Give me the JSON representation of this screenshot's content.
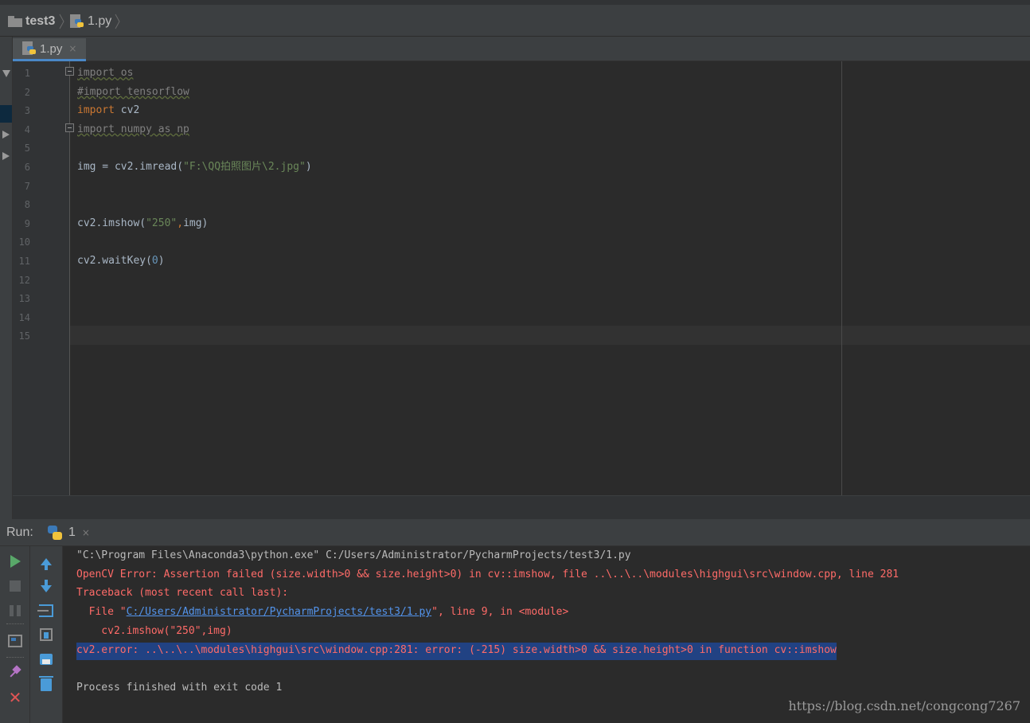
{
  "breadcrumb": {
    "project": "test3",
    "file": "1.py"
  },
  "editor": {
    "tab_label": "1.py",
    "tab_close": "×",
    "lines": [
      {
        "num": "1",
        "segments": [
          {
            "t": "import os",
            "c": "dim"
          }
        ]
      },
      {
        "num": "2",
        "segments": [
          {
            "t": "#import tensorflow",
            "c": "dim"
          }
        ]
      },
      {
        "num": "3",
        "segments": [
          {
            "t": "import ",
            "c": "kw"
          },
          {
            "t": "cv2",
            "c": ""
          }
        ]
      },
      {
        "num": "4",
        "segments": [
          {
            "t": "import numpy as np",
            "c": "dim"
          }
        ]
      },
      {
        "num": "5",
        "segments": []
      },
      {
        "num": "6",
        "segments": [
          {
            "t": "img = cv2.imread(",
            "c": ""
          },
          {
            "t": "\"F:\\QQ拍照图片\\2.jpg\"",
            "c": "str"
          },
          {
            "t": ")",
            "c": ""
          }
        ]
      },
      {
        "num": "7",
        "segments": []
      },
      {
        "num": "8",
        "segments": []
      },
      {
        "num": "9",
        "segments": [
          {
            "t": "cv2.imshow(",
            "c": ""
          },
          {
            "t": "\"250\"",
            "c": "str"
          },
          {
            "t": ",",
            "c": "kw"
          },
          {
            "t": "img)",
            "c": ""
          }
        ]
      },
      {
        "num": "10",
        "segments": []
      },
      {
        "num": "11",
        "segments": [
          {
            "t": "cv2.waitKey(",
            "c": ""
          },
          {
            "t": "0",
            "c": "num"
          },
          {
            "t": ")",
            "c": ""
          }
        ]
      },
      {
        "num": "12",
        "segments": []
      },
      {
        "num": "13",
        "segments": []
      },
      {
        "num": "14",
        "segments": []
      },
      {
        "num": "15",
        "segments": []
      }
    ]
  },
  "run": {
    "label": "Run:",
    "tab_label": "1",
    "tab_close": "×",
    "output": [
      {
        "style": "c-normal",
        "text": "\"C:\\Program Files\\Anaconda3\\python.exe\" C:/Users/Administrator/PycharmProjects/test3/1.py"
      },
      {
        "style": "c-err",
        "text": "OpenCV Error: Assertion failed (size.width>0 && size.height>0) in cv::imshow, file ..\\..\\..\\modules\\highgui\\src\\window.cpp, line 281"
      },
      {
        "style": "c-err",
        "text": "Traceback (most recent call last):"
      },
      {
        "style": "c-err",
        "parts": [
          {
            "t": "  File \"",
            "c": "c-err"
          },
          {
            "t": "C:/Users/Administrator/PycharmProjects/test3/1.py",
            "c": "c-link"
          },
          {
            "t": "\", line 9, in <module>",
            "c": "c-err"
          }
        ]
      },
      {
        "style": "c-err",
        "text": "    cv2.imshow(\"250\",img)"
      },
      {
        "style": "c-err c-sel",
        "text": "cv2.error: ..\\..\\..\\modules\\highgui\\src\\window.cpp:281: error: (-215) size.width>0 && size.height>0 in function cv::imshow"
      },
      {
        "style": "c-normal",
        "text": ""
      },
      {
        "style": "c-normal",
        "text": "Process finished with exit code 1"
      }
    ],
    "toolbar_icons": [
      "run-icon",
      "stop-icon",
      "pause-icon",
      "layout-icon",
      "pin-icon",
      "close-icon",
      "up-arrow-icon",
      "down-arrow-icon",
      "soft-wrap-icon",
      "scroll-to-end-icon",
      "print-icon",
      "trash-icon"
    ]
  },
  "watermark": "https://blog.csdn.net/congcong7267",
  "colors": {
    "background": "#2b2b2b",
    "panel": "#3c3f41",
    "keyword": "#cc7832",
    "string": "#6a8759",
    "number": "#6897bb",
    "error": "#ff6b68",
    "link": "#5394ec",
    "selection": "#214283"
  }
}
